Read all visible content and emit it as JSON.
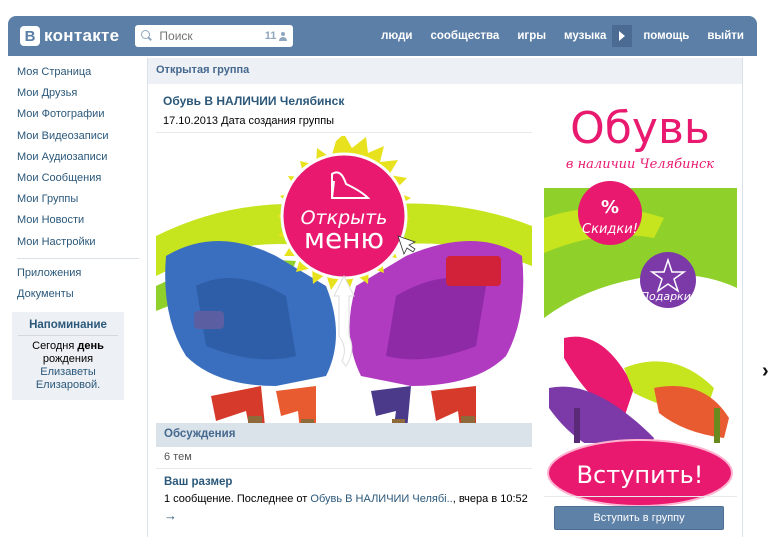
{
  "header": {
    "logo_mark": "B",
    "logo_text": "контакте",
    "search_placeholder": "Поиск",
    "search_count": "11",
    "nav": [
      "люди",
      "сообщества",
      "игры",
      "музыка",
      "помощь",
      "выйти"
    ]
  },
  "sidebar": {
    "items": [
      "Моя Страница",
      "Мои Друзья",
      "Мои Фотографии",
      "Мои Видеозаписи",
      "Мои Аудиозаписи",
      "Мои Сообщения",
      "Мои Группы",
      "Мои Новости",
      "Мои Настройки"
    ],
    "extra": [
      "Приложения",
      "Документы"
    ],
    "reminder": {
      "title": "Напоминание",
      "line1_pre": "Сегодня ",
      "line1_bold": "день",
      "line2": "рождения",
      "line3": "Елизаветы",
      "line4": "Елизаровой."
    }
  },
  "main": {
    "header": "Открытая группа",
    "group_name": "Обувь В НАЛИЧИИ Челябинск",
    "created_date": "17.10.2013",
    "created_label": "Дата создания группы",
    "banner": {
      "line1": "Открыть",
      "line2": "меню"
    },
    "side_banner": {
      "title": "Обувь",
      "subtitle": "в наличии Челябинск",
      "percent": "%",
      "discount": "Скидки!",
      "gifts": "Подарки!",
      "join": "Вступить!"
    },
    "discussions": {
      "title": "Обсуждения",
      "count": "6 тем",
      "topic_title": "Ваш размер",
      "topic_meta_pre": "1 сообщение. Последнее от ",
      "topic_author": "Обувь В НАЛИЧИИ Челябі..",
      "topic_meta_post": ", вчера в 10:52",
      "topic_arrow": "→"
    },
    "join_button": "Вступить в группу"
  },
  "colors": {
    "header_bg": "#5b7fa6",
    "link": "#2b587a",
    "accent_pink": "#e8196e",
    "accent_lime": "#c6e51e",
    "accent_purple": "#7b3aa8"
  }
}
